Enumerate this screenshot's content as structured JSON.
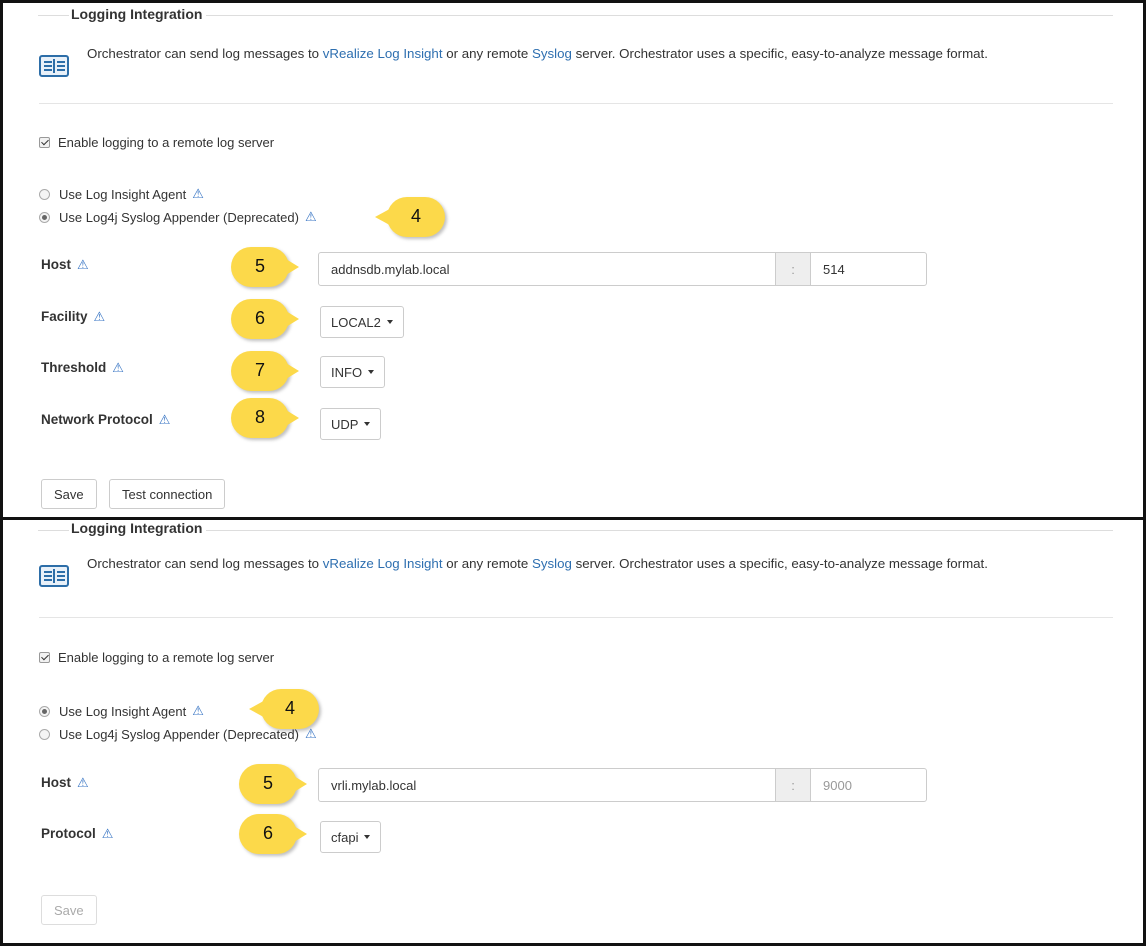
{
  "panels": [
    {
      "title": "Logging Integration",
      "intro": {
        "pre": "Orchestrator can send log messages to ",
        "link1": "vRealize Log Insight",
        "mid": " or any remote ",
        "link2": "Syslog",
        "post": " server. Orchestrator uses a specific, easy-to-analyze message format."
      },
      "enable_label": "Enable logging to a remote log server",
      "radio_agent": "Use Log Insight Agent",
      "radio_log4j": "Use Log4j Syslog Appender (Deprecated)",
      "selected": "log4j",
      "host_label": "Host",
      "host_value": "addnsdb.mylab.local",
      "sep": ":",
      "port_value": "514",
      "facility_label": "Facility",
      "facility_value": "LOCAL2",
      "threshold_label": "Threshold",
      "threshold_value": "INFO",
      "netproto_label": "Network Protocol",
      "netproto_value": "UDP",
      "save_label": "Save",
      "test_label": "Test connection",
      "callouts": [
        "4",
        "5",
        "6",
        "7",
        "8"
      ]
    },
    {
      "title": "Logging Integration",
      "intro": {
        "pre": "Orchestrator can send log messages to ",
        "link1": "vRealize Log Insight",
        "mid": " or any remote ",
        "link2": "Syslog",
        "post": " server. Orchestrator uses a specific, easy-to-analyze message format."
      },
      "enable_label": "Enable logging to a remote log server",
      "radio_agent": "Use Log Insight Agent",
      "radio_log4j": "Use Log4j Syslog Appender (Deprecated)",
      "selected": "agent",
      "host_label": "Host",
      "host_value": "vrli.mylab.local",
      "sep": ":",
      "port_placeholder": "9000",
      "protocol_label": "Protocol",
      "protocol_value": "cfapi",
      "save_label": "Save",
      "callouts": [
        "4",
        "5",
        "6"
      ]
    }
  ],
  "warn_glyph": "⚠",
  "colors": {
    "link": "#2e6fb0",
    "callout": "#fcd94a",
    "warn": "#3875c4"
  }
}
